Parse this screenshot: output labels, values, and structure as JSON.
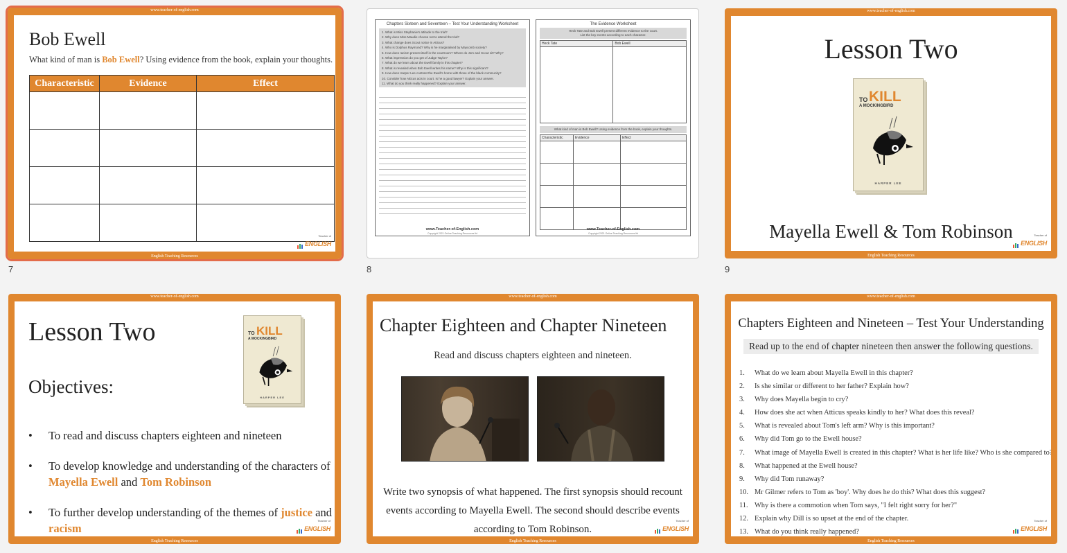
{
  "common": {
    "url": "www.teacher-of-english.com",
    "footer": "English Teaching Resources",
    "logo_top": "Teacher of",
    "logo_brand": "ENGLISH",
    "accent": "#e0872f"
  },
  "slide_numbers": [
    "7",
    "8",
    "9",
    "10",
    "11",
    "12"
  ],
  "slide7": {
    "title": "Bob Ewell",
    "sub_pre": "What kind of man is ",
    "sub_hl": "Bob Ewell",
    "sub_post": "? Using evidence from the book, explain your thoughts.",
    "headers": [
      "Characteristic",
      "Evidence",
      "Effect"
    ]
  },
  "slide8": {
    "left_title": "Chapters Sixteen and Seventeen – Test Your Understanding Worksheet",
    "questions": [
      "1.   What is Miss Stephanie's attitude to the trial?",
      "2.   Why does Miss Maudie choose not to attend the trial?",
      "3.   What change does Scout notice in Atticus?",
      "4.   Who is Dolphus Raymond? Why is he marginalised by Maycomb society?",
      "5.   How does racism present itself in the courtroom? Where do Jem and Scout sit?  Why?",
      "6.   What impression do you get of Judge Taylor?",
      "7.   What do we learn about the Ewell family in this chapter?",
      "8.   What is revealed when Bob Ewell writes his name? Why is this significant?",
      "9.   How does Harper Lee contrast the Ewell's home with those of the black community?",
      "10.  Consider how Atticus acts in court. Is he a good lawyer? Explain your answer.",
      "11.  What do you think really happened? Explain your answer."
    ],
    "right_title": "The Evidence Worksheet",
    "right_box_line1": "Heck Tate and Bob Ewell present different evidence to the court.",
    "right_box_line2": "List the key events according to each character.",
    "right_cols": [
      "Heck Tate",
      "Bob Ewell"
    ],
    "right_box2": "What kind of man is Bob Ewell? Using evidence from the book, explain your thoughts.",
    "right_cols2": [
      "Characteristic",
      "Evidence",
      "Effect"
    ],
    "footer_url": "www.Teacher-of-English.com",
    "copyright": "Copyright 2021 Online Teaching Resources ltd"
  },
  "book": {
    "to": "TO",
    "kill": "KILL",
    "mock": "A MOCKINGBIRD",
    "author": "HARPER LEE"
  },
  "slide9": {
    "title": "Lesson Two",
    "subtitle": "Mayella Ewell & Tom Robinson"
  },
  "slide10": {
    "title": "Lesson Two",
    "objectives": "Objectives:",
    "b1": "To read and discuss chapters eighteen and nineteen",
    "b2_pre": "To develop knowledge and understanding of the characters of ",
    "b2_hl1": "Mayella Ewell",
    "b2_mid": " and ",
    "b2_hl2": "Tom Robinson",
    "b3_pre": "To further develop understanding of the themes of ",
    "b3_hl1": "justice",
    "b3_mid": " and ",
    "b3_hl2": "racism"
  },
  "slide11": {
    "title": "Chapter Eighteen and Chapter Nineteen",
    "sub": "Read and discuss chapters eighteen and nineteen.",
    "body": "Write two synopsis of what happened. The first synopsis should recount events according to Mayella Ewell. The second should describe events according to Tom Robinson."
  },
  "slide12": {
    "title": "Chapters Eighteen and Nineteen – Test Your Understanding",
    "sub": "Read up to the end of chapter nineteen then answer the following questions.",
    "questions": [
      {
        "n": "1.",
        "t": "What do we learn about Mayella Ewell in this chapter?"
      },
      {
        "n": "2.",
        "t": "Is she similar or different to her father? Explain how?"
      },
      {
        "n": "3.",
        "t": "Why does Mayella begin to cry?"
      },
      {
        "n": "4.",
        "t": "How does she act when Atticus speaks kindly to her? What does this reveal?"
      },
      {
        "n": "5.",
        "t": "What is revealed about Tom's left arm? Why is this important?"
      },
      {
        "n": "6.",
        "t": "Why did Tom go to the Ewell house?"
      },
      {
        "n": "7.",
        "t": "What image of Mayella Ewell is created in this chapter? What is her life like? Who is she compared to?"
      },
      {
        "n": "8.",
        "t": "What happened at the Ewell house?"
      },
      {
        "n": "9.",
        "t": "Why did Tom runaway?"
      },
      {
        "n": "10.",
        "t": "Mr Gilmer refers to Tom as 'boy'. Why does he do this? What does this suggest?"
      },
      {
        "n": "11.",
        "t": "Why is there a commotion when Tom says, \"I felt right sorry for her?\""
      },
      {
        "n": "12.",
        "t": "Explain why Dill is so upset at the end of the chapter."
      },
      {
        "n": "13.",
        "t": "What do you think really happened?"
      }
    ]
  }
}
